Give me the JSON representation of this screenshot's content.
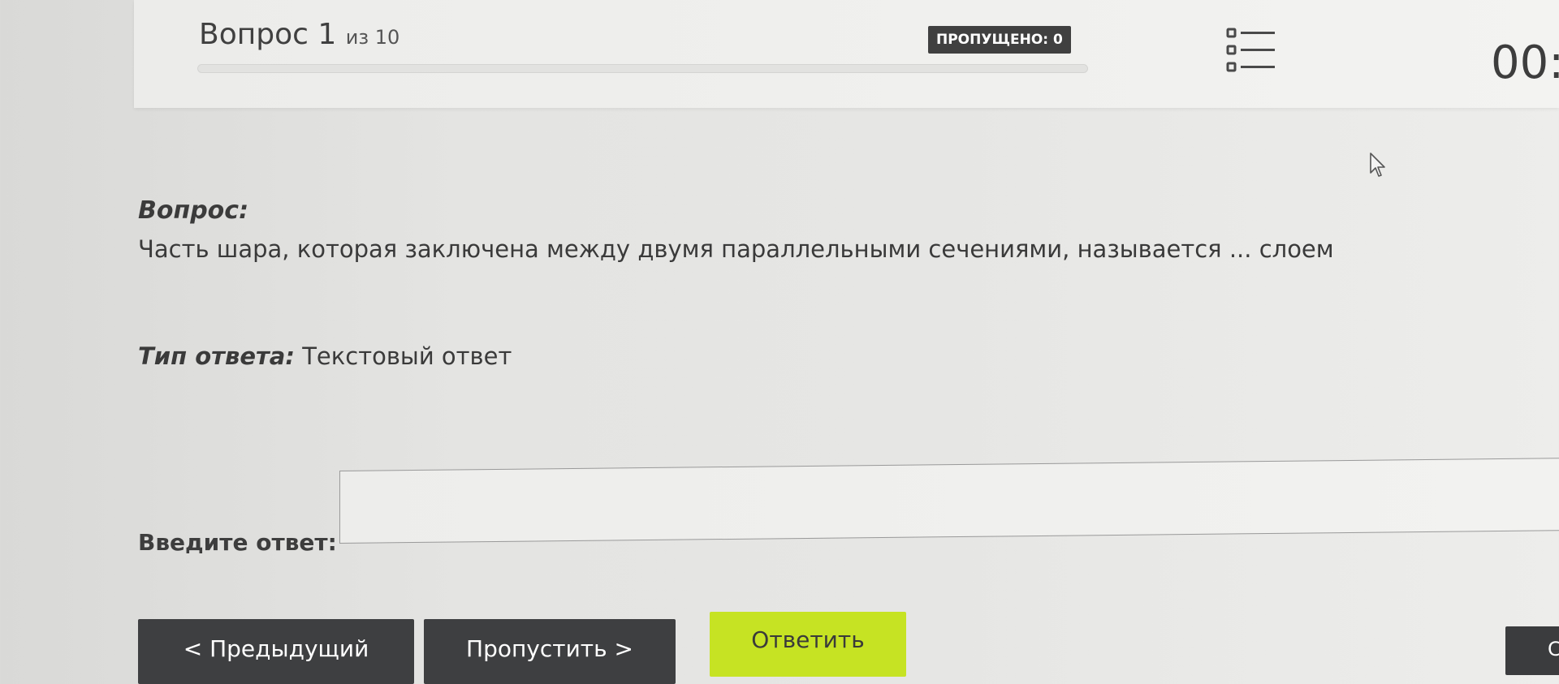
{
  "header": {
    "question_label": "Вопрос 1",
    "question_of": "из 10",
    "progress_fraction": 0,
    "skipped_badge": "ПРОПУЩЕНО: 0",
    "timer": "00:"
  },
  "question": {
    "label": "Вопрос:",
    "text": "Часть шара, которая заключена между двумя параллельными сечениями, называется ... слоем"
  },
  "answer_type": {
    "label": "Тип ответа:",
    "value": "Текстовый ответ"
  },
  "answer": {
    "label": "Введите ответ:",
    "value": ""
  },
  "buttons": {
    "prev": "< Предыдущий",
    "skip": "Пропустить >",
    "answer": "Ответить",
    "edge": "С"
  },
  "colors": {
    "answer_button": "#c6e323",
    "dark_button": "#3e3f41",
    "badge": "#404040"
  },
  "icons": {
    "question_list": "list-icon",
    "cursor": "mouse-cursor-icon"
  }
}
